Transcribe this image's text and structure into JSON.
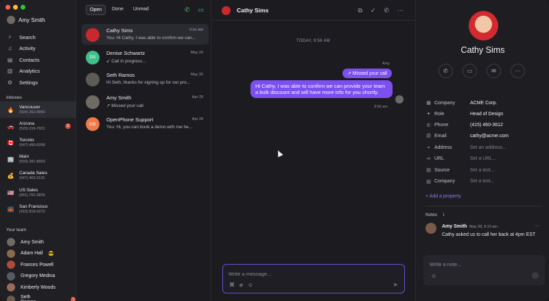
{
  "user": {
    "name": "Amy Smith"
  },
  "nav": [
    {
      "label": "Search",
      "icon": "search-icon",
      "glyph": "⌕"
    },
    {
      "label": "Activity",
      "icon": "bell-icon",
      "glyph": "♫"
    },
    {
      "label": "Contacts",
      "icon": "contacts-icon",
      "glyph": "▤"
    },
    {
      "label": "Analytics",
      "icon": "analytics-icon",
      "glyph": "▥"
    },
    {
      "label": "Settings",
      "icon": "gear-icon",
      "glyph": "⚙"
    }
  ],
  "inboxes_label": "Inboxes",
  "inboxes": [
    {
      "name": "Vancouver",
      "number": "(604) 262-8950",
      "flag": "🔥"
    },
    {
      "name": "Arizona",
      "number": "(520) 216-7921",
      "flag": "🚗",
      "badge": "3"
    },
    {
      "name": "Toronto",
      "number": "(647) 490-6268",
      "flag": "🇨🇦"
    },
    {
      "name": "Main",
      "number": "(833) 281-8953",
      "flag": "🏢"
    },
    {
      "name": "Canada Sales",
      "number": "(647) 403-3131",
      "flag": "💰"
    },
    {
      "name": "US Sales",
      "number": "(661) 762-3829",
      "flag": "🇺🇸"
    },
    {
      "name": "San Francisco",
      "number": "(415) 818-0272",
      "flag": "🌉"
    }
  ],
  "team_label": "Your team",
  "team": [
    {
      "name": "Amy Smith",
      "color": "#6f6a62"
    },
    {
      "name": "Adam Hall",
      "color": "#8a6a4f",
      "emoji": "😎"
    },
    {
      "name": "Frances Powell",
      "color": "#b04a3a"
    },
    {
      "name": "Gregory Medina",
      "color": "#5a5a66"
    },
    {
      "name": "Kimberly Woods",
      "color": "#9a6a5a"
    },
    {
      "name": "Seth Ramos",
      "color": "#6a5a4a",
      "badge": "1"
    }
  ],
  "tabs": [
    "Open",
    "Done",
    "Unread"
  ],
  "conversations": [
    {
      "name": "Cathy Sims",
      "date": "9:56 AM",
      "preview": "You: Hi Cathy, I was able to confirm we can...",
      "color": "#c9282f",
      "initials": ""
    },
    {
      "name": "Denise Schwartz",
      "date": "May 29",
      "preview": "↙ Call in progress...",
      "color": "#3fc08a",
      "initials": "DS"
    },
    {
      "name": "Seth Ramos",
      "date": "May 20",
      "preview": "Hi Seth, thanks for signing up for our pro...",
      "color": "#5e5a55",
      "initials": ""
    },
    {
      "name": "Amy Smith",
      "date": "Apr 28",
      "preview": "↗ Missed your call",
      "color": "#6f6a62",
      "initials": ""
    },
    {
      "name": "OpenPhone Support",
      "date": "Apr 28",
      "preview": "You: Hi, you can book a demo with me he...",
      "color": "#f07a4a",
      "initials": "OS"
    }
  ],
  "chat": {
    "title": "Cathy Sims",
    "day": "TODAY, 9:56 AM",
    "sender": "Amy",
    "missed": "↗ Missed your call",
    "message": "Hi Cathy, I was able to confirm we can provide your team a bulk discount and will have more info for you shortly.",
    "time": "9:56 am",
    "placeholder": "Write a message..."
  },
  "contact": {
    "name": "Cathy Sims",
    "properties": [
      {
        "label": "Company",
        "value": "ACME Corp.",
        "glyph": "▦",
        "empty": false
      },
      {
        "label": "Role",
        "value": "Head of Design",
        "glyph": "✦",
        "empty": false
      },
      {
        "label": "Phone",
        "value": "(415) 460-3612",
        "glyph": "✆",
        "empty": false
      },
      {
        "label": "Email",
        "value": "cathy@acme.com",
        "glyph": "@",
        "empty": false
      },
      {
        "label": "Address",
        "value": "Set an address...",
        "glyph": "⌖",
        "empty": true
      },
      {
        "label": "URL",
        "value": "Set a URL...",
        "glyph": "∞",
        "empty": true
      },
      {
        "label": "Source",
        "value": "Set a text...",
        "glyph": "▤",
        "empty": true
      },
      {
        "label": "Company",
        "value": "Set a text...",
        "glyph": "▤",
        "empty": true
      }
    ],
    "add_property": "+ Add a property",
    "notes_label": "Notes",
    "notes_count": "1",
    "note": {
      "author": "Amy Smith",
      "time": "May 28, 9:10 am",
      "text": "Cathy asked us to call her back at 4pm EST"
    },
    "note_placeholder": "Write a note..."
  }
}
